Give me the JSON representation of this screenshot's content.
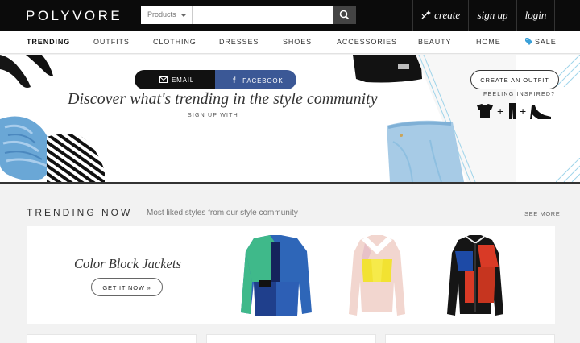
{
  "header": {
    "logo": "POLYVORE",
    "search": {
      "category": "Products",
      "placeholder": ""
    },
    "actions": {
      "create": "create",
      "signup": "sign up",
      "login": "login"
    }
  },
  "nav": {
    "items": [
      {
        "label": "TRENDING",
        "active": true
      },
      {
        "label": "OUTFITS"
      },
      {
        "label": "CLOTHING"
      },
      {
        "label": "DRESSES"
      },
      {
        "label": "SHOES"
      },
      {
        "label": "ACCESSORIES"
      },
      {
        "label": "BEAUTY"
      },
      {
        "label": "HOME"
      },
      {
        "label": "SALE"
      }
    ]
  },
  "hero": {
    "title": "Discover what's trending in the style community",
    "signup_label": "SIGN UP WITH",
    "email_label": "EMAIL",
    "facebook_label": "FACEBOOK",
    "inspired_label": "FEELING INSPIRED?",
    "create_outfit_label": "CREATE AN OUTFIT"
  },
  "trending": {
    "title": "TRENDING NOW",
    "subtitle": "Most liked styles from our style community",
    "see_more": "SEE MORE",
    "feature": {
      "title": "Color Block Jackets",
      "cta": "GET IT NOW »"
    }
  },
  "colors": {
    "topbar": "#0b0b0b",
    "facebook": "#3b5896",
    "sale_tag": "#3aa0d8",
    "hero_stripe": "#9fd4ea"
  }
}
